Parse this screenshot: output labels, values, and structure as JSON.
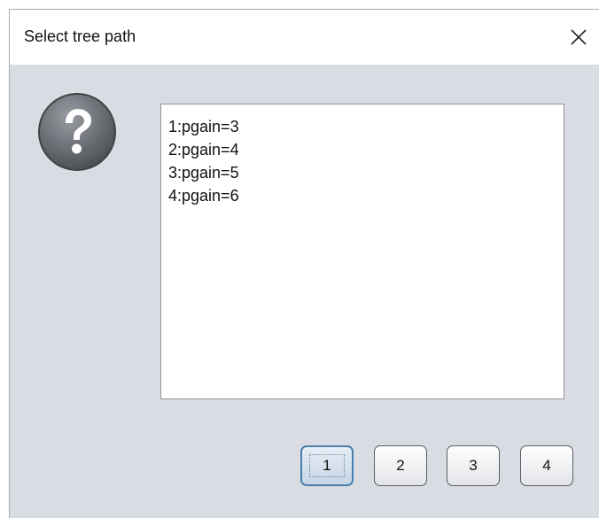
{
  "dialog": {
    "title": "Select tree path",
    "close_icon": "close-icon",
    "message_icon": "question-icon",
    "options": [
      "1:pgain=3",
      "2:pgain=4",
      "3:pgain=5",
      "4:pgain=6"
    ],
    "buttons": [
      "1",
      "2",
      "3",
      "4"
    ],
    "default_button": "1"
  },
  "colors": {
    "dialog_background": "#d9dce3",
    "titlebar_background": "#ffffff",
    "default_button_border": "#4a7fae"
  }
}
